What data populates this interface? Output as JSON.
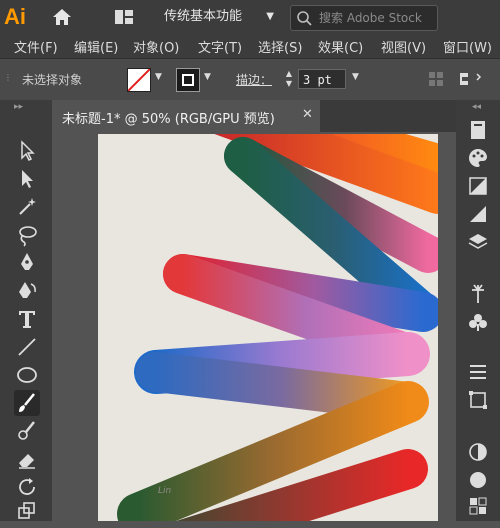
{
  "app": {
    "logo": "Ai"
  },
  "header": {
    "workspace": "传统基本功能",
    "search_placeholder": "搜索 Adobe Stock"
  },
  "menu": [
    "文件(F)",
    "编辑(E)",
    "对象(O)",
    "文字(T)",
    "选择(S)",
    "效果(C)",
    "视图(V)",
    "窗口(W)"
  ],
  "control_bar": {
    "selection_status": "未选择对象",
    "stroke_label": "描边：",
    "stroke_width": "3 pt"
  },
  "document": {
    "tab_title": "未标题-1* @ 50% (RGB/GPU 预览)",
    "close_glyph": "✕",
    "signature": "Lin"
  },
  "icons": {
    "toolbar": [
      "selection-tool-icon",
      "direct-selection-tool-icon",
      "magic-wand-tool-icon",
      "lasso-tool-icon",
      "pen-tool-icon",
      "curvature-tool-icon",
      "type-tool-icon",
      "line-segment-tool-icon",
      "ellipse-tool-icon",
      "paintbrush-tool-icon",
      "blob-brush-tool-icon",
      "eraser-tool-icon",
      "rotate-tool-icon",
      "scale-tool-icon"
    ],
    "right_panel": [
      "panel-icon",
      "color-palette-icon",
      "gradient-icon",
      "layers-icon",
      "appearance-icon",
      "symbols-icon",
      "club-icon",
      "align-icon",
      "transform-icon",
      "transparency-icon",
      "stroke-icon",
      "graphic-styles-icon"
    ]
  },
  "colors": {
    "accent_logo": "#ff9a00",
    "chrome_dark": "#3c3c3c",
    "artboard": "#e9e6df"
  }
}
